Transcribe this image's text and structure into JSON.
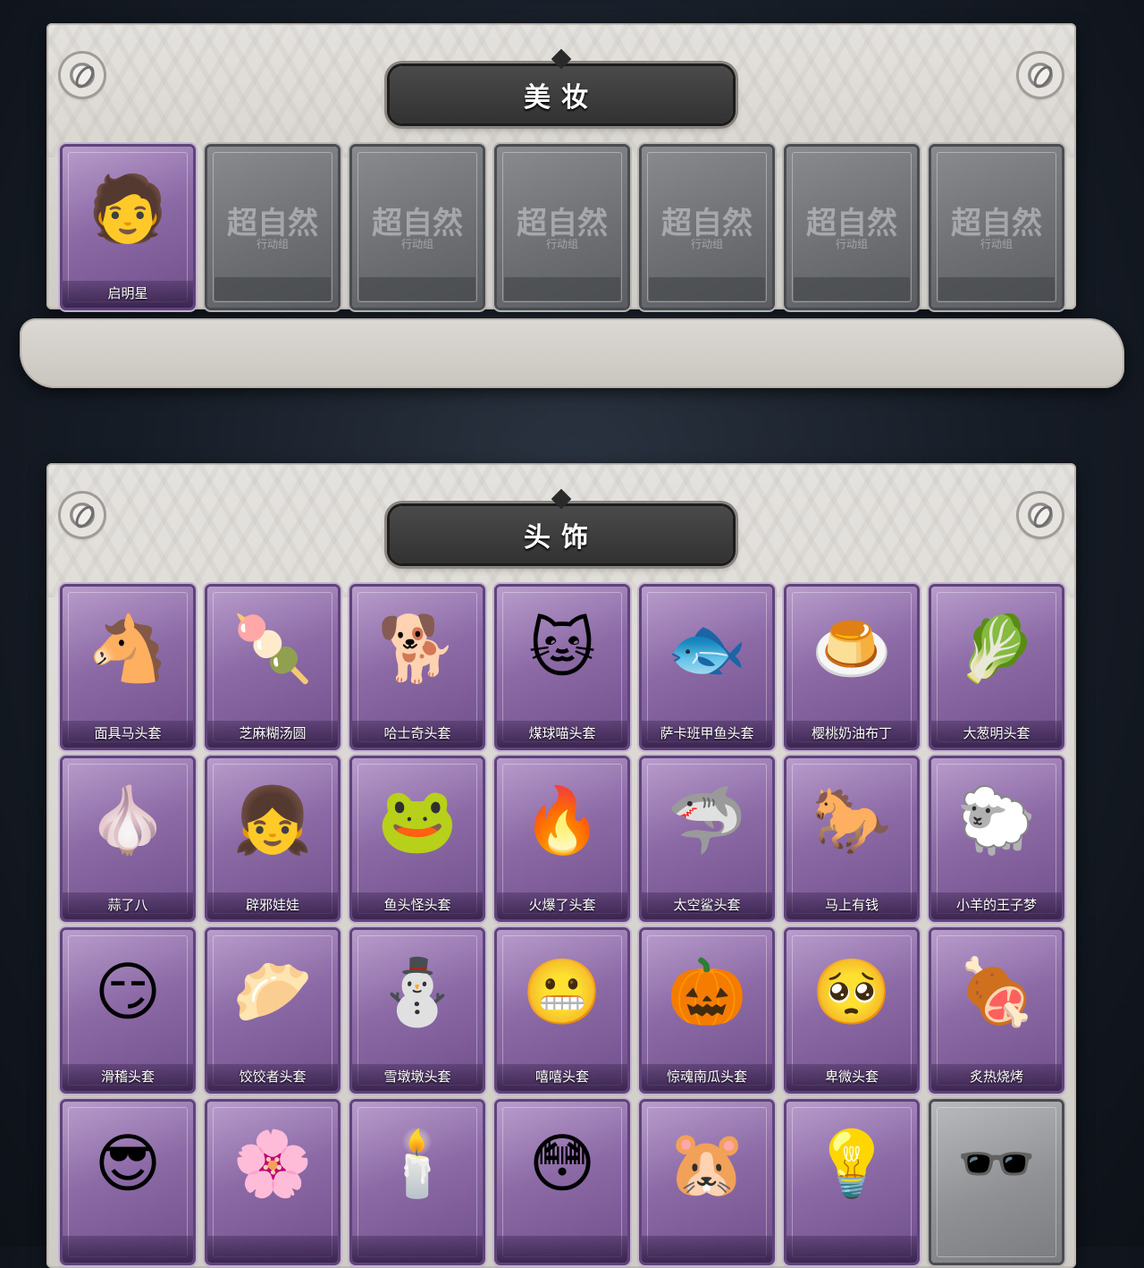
{
  "makeup": {
    "title": "美妆",
    "items": [
      {
        "name": "启明星",
        "icon": "🧑",
        "owned": true
      },
      {
        "locked": true,
        "logo": "超自然",
        "logo_sub": "行动组"
      },
      {
        "locked": true,
        "logo": "超自然",
        "logo_sub": "行动组"
      },
      {
        "locked": true,
        "logo": "超自然",
        "logo_sub": "行动组"
      },
      {
        "locked": true,
        "logo": "超自然",
        "logo_sub": "行动组"
      },
      {
        "locked": true,
        "logo": "超自然",
        "logo_sub": "行动组"
      },
      {
        "locked": true,
        "logo": "超自然",
        "logo_sub": "行动组"
      }
    ]
  },
  "headwear": {
    "title": "头饰",
    "items": [
      {
        "name": "面具马头套",
        "icon": "🐴"
      },
      {
        "name": "芝麻糊汤圆",
        "icon": "🍡"
      },
      {
        "name": "哈士奇头套",
        "icon": "🐕"
      },
      {
        "name": "煤球喵头套",
        "icon": "🐱"
      },
      {
        "name": "萨卡班甲鱼头套",
        "icon": "🐟"
      },
      {
        "name": "樱桃奶油布丁",
        "icon": "🍮"
      },
      {
        "name": "大葱明头套",
        "icon": "🥬"
      },
      {
        "name": "蒜了八",
        "icon": "🧄"
      },
      {
        "name": "辟邪娃娃",
        "icon": "👧"
      },
      {
        "name": "鱼头怪头套",
        "icon": "🐸"
      },
      {
        "name": "火爆了头套",
        "icon": "🔥"
      },
      {
        "name": "太空鲨头套",
        "icon": "🦈"
      },
      {
        "name": "马上有钱",
        "icon": "🐎"
      },
      {
        "name": "小羊的王子梦",
        "icon": "🐑"
      },
      {
        "name": "滑稽头套",
        "icon": "😏"
      },
      {
        "name": "饺饺者头套",
        "icon": "🥟"
      },
      {
        "name": "雪墩墩头套",
        "icon": "⛄"
      },
      {
        "name": "嘻嘻头套",
        "icon": "😬"
      },
      {
        "name": "惊魂南瓜头套",
        "icon": "🎃"
      },
      {
        "name": "卑微头套",
        "icon": "🥺"
      },
      {
        "name": "炙热烧烤",
        "icon": "🍖"
      },
      {
        "name": "",
        "icon": "😎"
      },
      {
        "name": "",
        "icon": "🌸"
      },
      {
        "name": "",
        "icon": "🕯️"
      },
      {
        "name": "",
        "icon": "😳"
      },
      {
        "name": "",
        "icon": "🐹"
      },
      {
        "name": "",
        "icon": "💡"
      },
      {
        "name": "",
        "icon": "🕶️",
        "grey": true
      }
    ]
  },
  "colors": {
    "card_purple": "#8c6aa6",
    "card_locked": "#6e7074",
    "banner": "#3f3e3e",
    "panel": "#dcd9d4"
  }
}
